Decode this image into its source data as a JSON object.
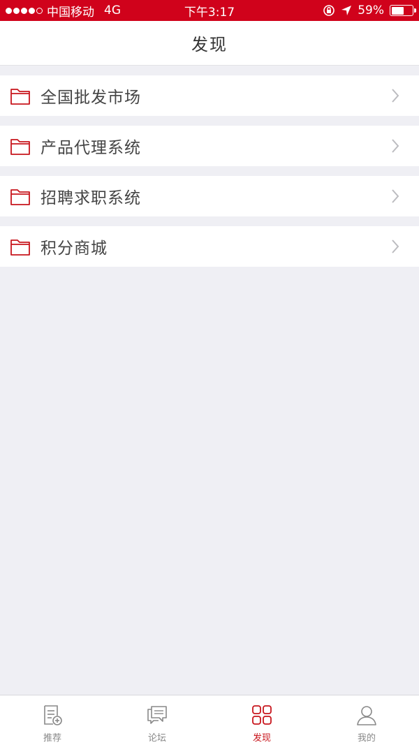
{
  "status_bar": {
    "carrier": "中国移动",
    "network": "4G",
    "time": "下午3:17",
    "battery_text": "59%",
    "battery_level": 0.59
  },
  "header": {
    "title": "发现"
  },
  "menu": {
    "items": [
      {
        "label": "全国批发市场",
        "icon": "folder-icon"
      },
      {
        "label": "产品代理系统",
        "icon": "folder-icon"
      },
      {
        "label": "招聘求职系统",
        "icon": "folder-icon"
      },
      {
        "label": "积分商城",
        "icon": "folder-icon"
      }
    ]
  },
  "tab_bar": {
    "tabs": [
      {
        "label": "推荐",
        "icon": "recommend-icon",
        "active": false
      },
      {
        "label": "论坛",
        "icon": "forum-icon",
        "active": false
      },
      {
        "label": "发现",
        "icon": "discover-icon",
        "active": true
      },
      {
        "label": "我的",
        "icon": "profile-icon",
        "active": false
      }
    ]
  },
  "colors": {
    "brand_red": "#d0021b",
    "icon_red": "#c8161d",
    "background": "#efeff4",
    "inactive_gray": "#888888"
  }
}
